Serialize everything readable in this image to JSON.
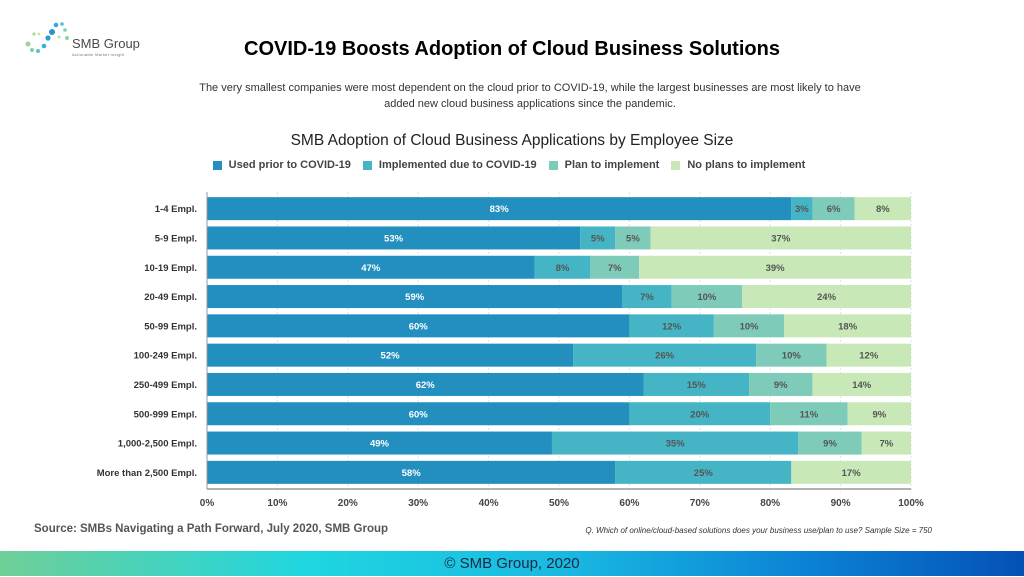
{
  "logo": {
    "name": "SMB Group",
    "tagline": "Actionable Market Insight"
  },
  "title": "COVID-19 Boosts Adoption of Cloud Business Solutions",
  "subtitle": "The very smallest companies were most dependent on the cloud prior to COVID-19, while the largest businesses are most likely to have added new cloud business applications since the pandemic.",
  "source": "Source: SMBs Navigating a Path Forward, July 2020, SMB Group",
  "question": "Q. Which of online/cloud-based solutions does your business use/plan to use? Sample Size = 750",
  "footer": "© SMB Group, 2020",
  "chart_data": {
    "type": "bar",
    "orientation": "horizontal",
    "stacked": "100%",
    "title": "SMB Adoption of Cloud Business Applications by Employee Size",
    "xlabel": "",
    "ylabel": "",
    "xlim": [
      0,
      100
    ],
    "xticks": [
      "0%",
      "10%",
      "20%",
      "30%",
      "40%",
      "50%",
      "60%",
      "70%",
      "80%",
      "90%",
      "100%"
    ],
    "grid": true,
    "legend_position": "top",
    "categories": [
      "1-4 Empl.",
      "5-9 Empl.",
      "10-19 Empl.",
      "20-49 Empl.",
      "50-99 Empl.",
      "100-249 Empl.",
      "250-499 Empl.",
      "500-999 Empl.",
      "1,000-2,500 Empl.",
      "More than 2,500 Empl."
    ],
    "series": [
      {
        "name": "Used prior to COVID-19",
        "color": "#228fbf",
        "label_color": "#ffffff",
        "values": [
          83,
          53,
          47,
          59,
          60,
          52,
          62,
          60,
          49,
          58
        ]
      },
      {
        "name": "Implemented due to COVID-19",
        "color": "#45b4c4",
        "label_color": "#555555",
        "values": [
          3,
          5,
          8,
          7,
          12,
          26,
          15,
          20,
          35,
          25
        ]
      },
      {
        "name": "Plan to implement",
        "color": "#7fcbb9",
        "label_color": "#555555",
        "values": [
          6,
          5,
          7,
          10,
          10,
          10,
          9,
          11,
          9,
          0
        ]
      },
      {
        "name": "No plans to implement",
        "color": "#c8e8b7",
        "label_color": "#555555",
        "values": [
          8,
          37,
          39,
          24,
          18,
          12,
          14,
          9,
          7,
          17
        ]
      }
    ]
  }
}
